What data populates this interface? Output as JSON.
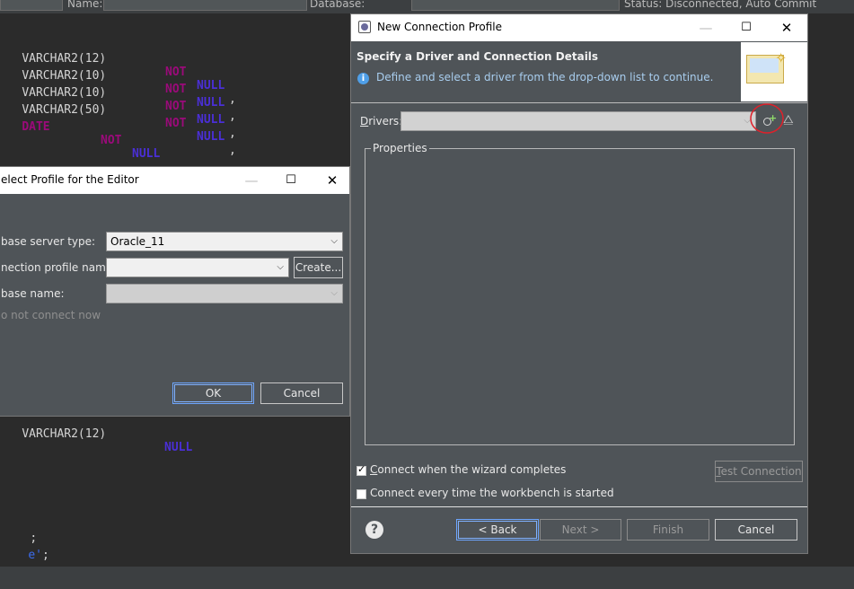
{
  "toolbar": {
    "name_label": "Name:",
    "database_label": "Database:",
    "status_text": "Status: Disconnected, Auto Commit"
  },
  "editor": {
    "lines": [
      {
        "type": "VARCHAR2(12)",
        "k1": "NOT",
        "k2": "NULL",
        "p": ","
      },
      {
        "type": "VARCHAR2(10)",
        "k1": "NOT",
        "k2": "NULL",
        "p": ","
      },
      {
        "type": "VARCHAR2(10)",
        "k1": "NOT",
        "k2": "NULL",
        "p": ","
      },
      {
        "type": "VARCHAR2(50)",
        "k1": "NOT",
        "k2": "NULL",
        "p": ","
      }
    ],
    "date_line": {
      "type": "DATE",
      "k1": "NOT",
      "k2": "NULL"
    },
    "lower_line": {
      "type": "VARCHAR2(12)",
      "k2": "NULL"
    },
    "semicolon": ";",
    "string_tail": "e'",
    "string_semicolon": ";"
  },
  "select_profile_dialog": {
    "title": "elect Profile for the Editor",
    "db_type_label": "base server type:",
    "db_type_value": "Oracle_11",
    "profile_label": "nection profile name:",
    "profile_value": "",
    "create_button": "Create...",
    "dbname_label": "base name:",
    "dbname_value": "",
    "not_connect_text": "o not connect now",
    "ok_button": "OK",
    "cancel_button": "Cancel"
  },
  "ncp_dialog": {
    "title": "New Connection Profile",
    "header_title": "Specify a Driver and Connection Details",
    "header_info": "Define and select a driver from the drop-down list to continue.",
    "drivers_label": "Drivers:",
    "drivers_value": "",
    "properties_label": "Properties",
    "connect_when_label": "Connect when the wizard completes",
    "connect_when_checked": true,
    "connect_every_label": "Connect every time the workbench is started",
    "connect_every_checked": false,
    "test_connection_button": "Test Connection",
    "back_button": "< Back",
    "next_button": "Next >",
    "finish_button": "Finish",
    "cancel_button": "Cancel"
  },
  "colors": {
    "editor_bg": "#2b2b2b",
    "dialog_bg": "#4f5458",
    "keyword_not": "#9b0a7a",
    "keyword_null": "#4a2fd6",
    "annotation_circle": "#e0202a",
    "info_icon": "#4f9fe8"
  }
}
